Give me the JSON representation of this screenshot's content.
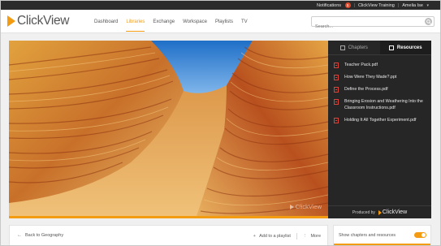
{
  "colors": {
    "accent": "#f39c12",
    "dark_panel": "#262626",
    "pdf_red": "#d9453a"
  },
  "utility_bar": {
    "notifications_label": "Notifications",
    "notifications_count": "1",
    "account_label": "ClickView Training",
    "user_label": "Amelia Ise"
  },
  "header": {
    "logo_text": "ClickView",
    "nav": [
      "Dashboard",
      "Libraries",
      "Exchange",
      "Workspace",
      "Playlists",
      "TV"
    ],
    "active_nav": "Libraries",
    "search_placeholder": "Search..."
  },
  "player": {
    "watermark_text": "ClickView",
    "progress_fraction": 1.0,
    "tabs": {
      "chapters": "Chapters",
      "resources": "Resources",
      "active": "Resources"
    },
    "resources": [
      "Teacher Pack.pdf",
      "How Were They Made?.ppt",
      "Define the Process.pdf",
      "Bringing Erosion and Weathering Into the Classroom Instructions.pdf",
      "Holding It All Together Experiment.pdf"
    ],
    "produced_by_label": "Produced by",
    "produced_by_brand": "ClickView"
  },
  "footer": {
    "back_label": "Back to Geography",
    "add_to_playlist_label": "Add to a playlist",
    "more_label": "More",
    "toggle_label": "Show chapters and resources",
    "toggle_on": true
  }
}
